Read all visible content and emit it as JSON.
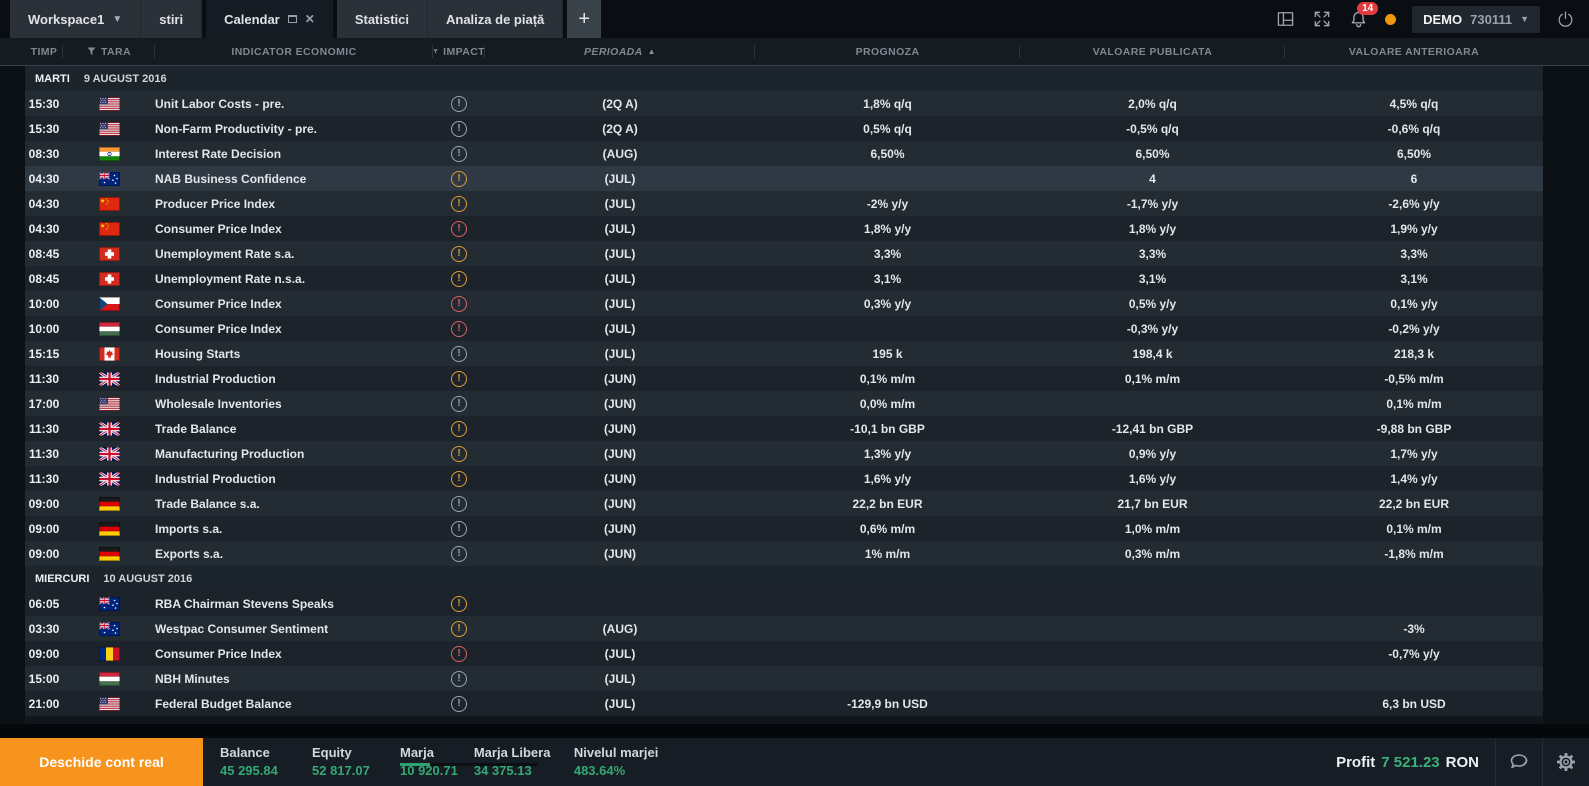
{
  "topbar": {
    "workspace_label": "Workspace1",
    "tab_stiri": "stiri",
    "tab_calendar": "Calendar",
    "tab_statistici": "Statistici",
    "tab_analiza": "Analiza de piață",
    "add_tab": "+",
    "notification_count": "14",
    "account_type": "DEMO",
    "account_number": "730111"
  },
  "columns": [
    {
      "label": "TIMP"
    },
    {
      "label": "TARA",
      "filter": true
    },
    {
      "label": "INDICATOR ECONOMIC"
    },
    {
      "label": "IMPACT",
      "filter": true
    },
    {
      "label": "PERIOADA",
      "sort": "asc",
      "italic": true
    },
    {
      "label": "PROGNOZA"
    },
    {
      "label": "VALOARE PUBLICATA"
    },
    {
      "label": "VALOARE ANTERIOARA"
    }
  ],
  "calendar": {
    "groups": [
      {
        "day": "MARTI",
        "date": "9 AUGUST 2016",
        "events": [
          {
            "time": "15:30",
            "country": "us",
            "indicator": "Unit Labor Costs - pre.",
            "impact": "low",
            "period": "(2Q A)",
            "prognoza": "1,8% q/q",
            "publicata": "2,0% q/q",
            "anterioara": "4,5% q/q"
          },
          {
            "time": "15:30",
            "country": "us",
            "indicator": "Non-Farm Productivity - pre.",
            "impact": "low",
            "period": "(2Q A)",
            "prognoza": "0,5% q/q",
            "publicata": "-0,5% q/q",
            "anterioara": "-0,6% q/q"
          },
          {
            "time": "08:30",
            "country": "in",
            "indicator": "Interest Rate Decision",
            "impact": "low",
            "period": "(AUG)",
            "prognoza": "6,50%",
            "publicata": "6,50%",
            "anterioara": "6,50%"
          },
          {
            "time": "04:30",
            "country": "au",
            "indicator": "NAB Business Confidence",
            "impact": "medium",
            "period": "(JUL)",
            "prognoza": "",
            "publicata": "4",
            "anterioara": "6",
            "selected": true
          },
          {
            "time": "04:30",
            "country": "cn",
            "indicator": "Producer Price Index",
            "impact": "medium",
            "period": "(JUL)",
            "prognoza": "-2% y/y",
            "publicata": "-1,7% y/y",
            "anterioara": "-2,6% y/y"
          },
          {
            "time": "04:30",
            "country": "cn",
            "indicator": "Consumer Price Index",
            "impact": "high",
            "period": "(JUL)",
            "prognoza": "1,8% y/y",
            "publicata": "1,8% y/y",
            "anterioara": "1,9% y/y"
          },
          {
            "time": "08:45",
            "country": "ch",
            "indicator": "Unemployment Rate s.a.",
            "impact": "medium",
            "period": "(JUL)",
            "prognoza": "3,3%",
            "publicata": "3,3%",
            "anterioara": "3,3%"
          },
          {
            "time": "08:45",
            "country": "ch",
            "indicator": "Unemployment Rate n.s.a.",
            "impact": "medium",
            "period": "(JUL)",
            "prognoza": "3,1%",
            "publicata": "3,1%",
            "anterioara": "3,1%"
          },
          {
            "time": "10:00",
            "country": "cz",
            "indicator": "Consumer Price Index",
            "impact": "high",
            "period": "(JUL)",
            "prognoza": "0,3% y/y",
            "publicata": "0,5% y/y",
            "anterioara": "0,1% y/y"
          },
          {
            "time": "10:00",
            "country": "hu",
            "indicator": "Consumer Price Index",
            "impact": "high",
            "period": "(JUL)",
            "prognoza": "",
            "publicata": "-0,3% y/y",
            "anterioara": "-0,2% y/y"
          },
          {
            "time": "15:15",
            "country": "ca",
            "indicator": "Housing Starts",
            "impact": "low",
            "period": "(JUL)",
            "prognoza": "195 k",
            "publicata": "198,4 k",
            "anterioara": "218,3 k"
          },
          {
            "time": "11:30",
            "country": "gb",
            "indicator": "Industrial Production",
            "impact": "medium",
            "period": "(JUN)",
            "prognoza": "0,1% m/m",
            "publicata": "0,1% m/m",
            "anterioara": "-0,5% m/m"
          },
          {
            "time": "17:00",
            "country": "us",
            "indicator": "Wholesale Inventories",
            "impact": "low",
            "period": "(JUN)",
            "prognoza": "0,0% m/m",
            "publicata": "",
            "anterioara": "0,1% m/m"
          },
          {
            "time": "11:30",
            "country": "gb",
            "indicator": "Trade Balance",
            "impact": "medium",
            "period": "(JUN)",
            "prognoza": "-10,1 bn GBP",
            "publicata": "-12,41 bn GBP",
            "anterioara": "-9,88 bn GBP"
          },
          {
            "time": "11:30",
            "country": "gb",
            "indicator": "Manufacturing Production",
            "impact": "medium",
            "period": "(JUN)",
            "prognoza": "1,3% y/y",
            "publicata": "0,9% y/y",
            "anterioara": "1,7% y/y"
          },
          {
            "time": "11:30",
            "country": "gb",
            "indicator": "Industrial Production",
            "impact": "medium",
            "period": "(JUN)",
            "prognoza": "1,6% y/y",
            "publicata": "1,6% y/y",
            "anterioara": "1,4% y/y"
          },
          {
            "time": "09:00",
            "country": "de",
            "indicator": "Trade Balance s.a.",
            "impact": "low",
            "period": "(JUN)",
            "prognoza": "22,2 bn EUR",
            "publicata": "21,7 bn EUR",
            "anterioara": "22,2 bn EUR"
          },
          {
            "time": "09:00",
            "country": "de",
            "indicator": "Imports s.a.",
            "impact": "low",
            "period": "(JUN)",
            "prognoza": "0,6% m/m",
            "publicata": "1,0% m/m",
            "anterioara": "0,1% m/m"
          },
          {
            "time": "09:00",
            "country": "de",
            "indicator": "Exports s.a.",
            "impact": "low",
            "period": "(JUN)",
            "prognoza": "1% m/m",
            "publicata": "0,3% m/m",
            "anterioara": "-1,8% m/m"
          }
        ]
      },
      {
        "day": "MIERCURI",
        "date": "10 AUGUST 2016",
        "events": [
          {
            "time": "06:05",
            "country": "au",
            "indicator": "RBA Chairman Stevens Speaks",
            "impact": "medium",
            "period": "",
            "prognoza": "",
            "publicata": "",
            "anterioara": ""
          },
          {
            "time": "03:30",
            "country": "au",
            "indicator": "Westpac Consumer Sentiment",
            "impact": "medium",
            "period": "(AUG)",
            "prognoza": "",
            "publicata": "",
            "anterioara": "-3%"
          },
          {
            "time": "09:00",
            "country": "ro",
            "indicator": "Consumer Price Index",
            "impact": "high",
            "period": "(JUL)",
            "prognoza": "",
            "publicata": "",
            "anterioara": "-0,7% y/y"
          },
          {
            "time": "15:00",
            "country": "hu",
            "indicator": "NBH Minutes",
            "impact": "low",
            "period": "(JUL)",
            "prognoza": "",
            "publicata": "",
            "anterioara": ""
          },
          {
            "time": "21:00",
            "country": "us",
            "indicator": "Federal Budget Balance",
            "impact": "low",
            "period": "(JUL)",
            "prognoza": "-129,9 bn USD",
            "publicata": "",
            "anterioara": "6,3 bn USD"
          }
        ]
      }
    ]
  },
  "footer": {
    "open_account_label": "Deschide cont real",
    "stats": [
      {
        "key": "balance",
        "label": "Balance",
        "value": "45 295.84"
      },
      {
        "key": "equity",
        "label": "Equity",
        "value": "52 817.07"
      },
      {
        "key": "marja",
        "label": "Marja",
        "value": "10 920.71",
        "has_bar": true
      },
      {
        "key": "marjalibera",
        "label": "Marja Libera",
        "value": "34 375.13"
      },
      {
        "key": "nivelulmarjei",
        "label": "Nivelul marjei",
        "value": "483.64%"
      }
    ],
    "profit_label": "Profit",
    "profit_value": "7 521.23",
    "currency": "RON"
  },
  "colors": {
    "accent_orange": "#f7941e",
    "value_green": "#35a873",
    "profit_green": "#3bb277",
    "impact_low": "#9ba5ad",
    "impact_medium": "#dd9d3d",
    "impact_high": "#d96161",
    "badge_red": "#e23b3f",
    "selected_row": "#2e3944"
  }
}
